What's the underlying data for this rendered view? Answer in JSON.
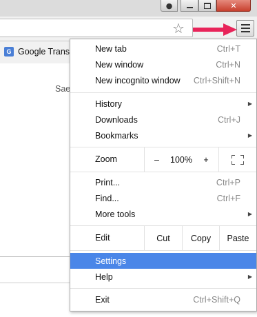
{
  "bookmarks": {
    "google_translate": "Google Transl"
  },
  "page": {
    "snippet": "Sae"
  },
  "menu": {
    "new_tab": {
      "label": "New tab",
      "shortcut": "Ctrl+T"
    },
    "new_window": {
      "label": "New window",
      "shortcut": "Ctrl+N"
    },
    "new_incognito": {
      "label": "New incognito window",
      "shortcut": "Ctrl+Shift+N"
    },
    "history": {
      "label": "History"
    },
    "downloads": {
      "label": "Downloads",
      "shortcut": "Ctrl+J"
    },
    "bookmarks": {
      "label": "Bookmarks"
    },
    "zoom": {
      "label": "Zoom",
      "minus": "–",
      "value": "100%",
      "plus": "+"
    },
    "print": {
      "label": "Print...",
      "shortcut": "Ctrl+P"
    },
    "find": {
      "label": "Find...",
      "shortcut": "Ctrl+F"
    },
    "more_tools": {
      "label": "More tools"
    },
    "edit": {
      "label": "Edit",
      "cut": "Cut",
      "copy": "Copy",
      "paste": "Paste"
    },
    "settings": {
      "label": "Settings"
    },
    "help": {
      "label": "Help"
    },
    "exit": {
      "label": "Exit",
      "shortcut": "Ctrl+Shift+Q"
    }
  },
  "colors": {
    "highlight": "#4a86e8",
    "annotation_arrow": "#e8245a"
  }
}
